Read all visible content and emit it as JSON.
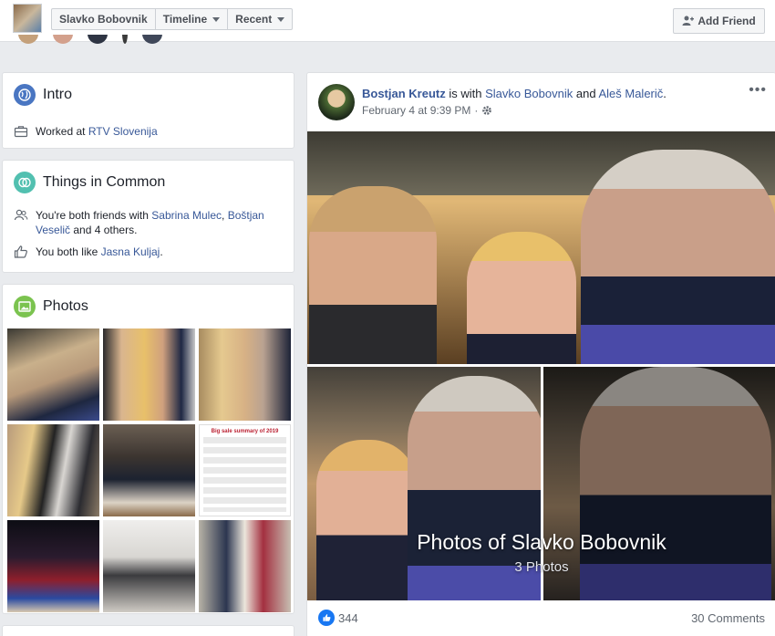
{
  "header": {
    "profile_name": "Slavko Bobovnik",
    "timeline_label": "Timeline",
    "recent_label": "Recent",
    "add_friend_label": "Add Friend"
  },
  "intro": {
    "title": "Intro",
    "work_prefix": "Worked at",
    "work_place": "RTV Slovenija"
  },
  "common": {
    "title": "Things in Common",
    "friends_prefix": "You're both friends with",
    "friend_1": "Sabrina Mulec",
    "sep": ",",
    "friend_2": "Boštjan Veselič",
    "friends_suffix": "and 4 others.",
    "like_prefix": "You both like",
    "like_page": "Jasna Kuljaj",
    "like_suffix": "."
  },
  "photos": {
    "title": "Photos"
  },
  "post": {
    "author": "Bostjan Kreutz",
    "with_text": "is with",
    "tag_1": "Slavko Bobovnik",
    "and_text": "and",
    "tag_2": "Aleš Malerič",
    "period": ".",
    "timestamp": "February 4 at 9:39 PM",
    "dot": "·",
    "more": "•••",
    "album_title": "Photos of Slavko Bobovnik",
    "album_count": "3 Photos",
    "like_count": "344",
    "comments": "30 Comments"
  },
  "sale_image": {
    "title": "Big sale summary of 2019"
  },
  "icons": {
    "intro": "globe-icon",
    "common": "link-icon",
    "photos": "image-icon",
    "work": "briefcase-icon",
    "friends": "friends-icon",
    "like": "thumbs-up-icon",
    "privacy": "gear-icon",
    "add_friend": "add-person-icon"
  },
  "colors": {
    "link": "#385898",
    "intro_icon": "#4a76c2",
    "common_icon": "#52c0b0",
    "photos_icon": "#7bc34f",
    "like_blue": "#1877f2",
    "page_bg": "#e9ebee"
  }
}
